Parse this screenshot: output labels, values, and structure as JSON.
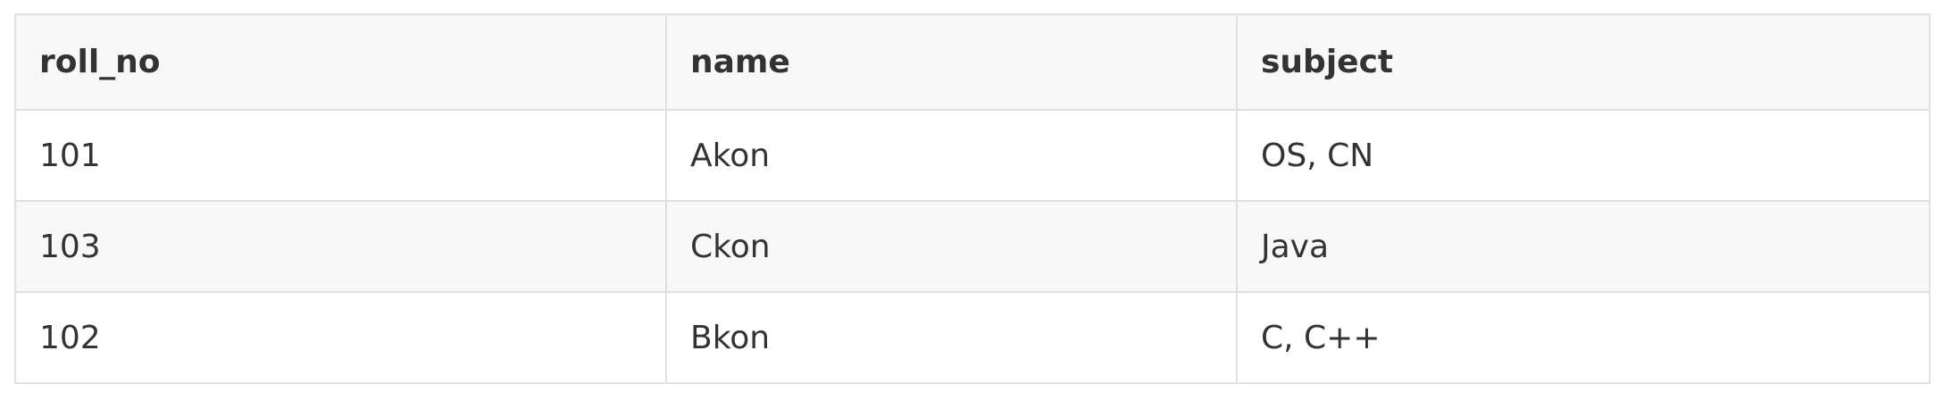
{
  "table": {
    "headers": [
      "roll_no",
      "name",
      "subject"
    ],
    "rows": [
      [
        "101",
        "Akon",
        "OS, CN"
      ],
      [
        "103",
        "Ckon",
        "Java"
      ],
      [
        "102",
        "Bkon",
        "C, C++"
      ]
    ]
  }
}
